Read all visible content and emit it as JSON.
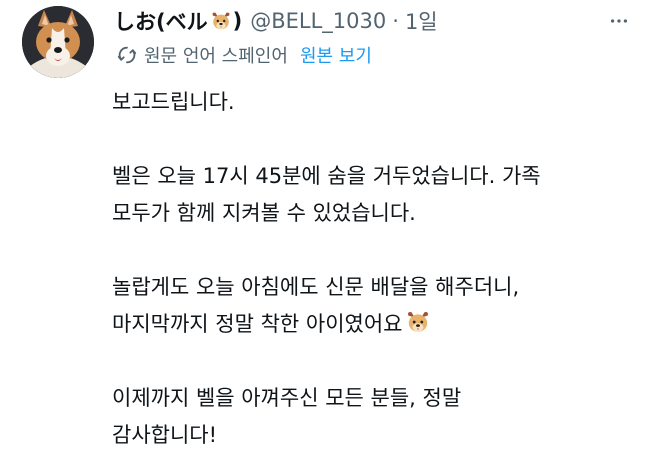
{
  "author": {
    "display_name_text": "しお(ベル",
    "display_name_close": ")",
    "name_emoji": "dog-face-emoji",
    "handle": "@BELL_1030",
    "separator": "·",
    "timestamp": "1일"
  },
  "translation": {
    "source_label": "원문 언어 스페인어",
    "view_original_label": "원본 보기"
  },
  "tweet": {
    "paragraph1_line1": "보고드립니다.",
    "paragraph2_line1": "벨은 오늘 17시 45분에 숨을 거두었습니다. 가족",
    "paragraph2_line2": "모두가 함께 지켜볼 수 있었습니다.",
    "paragraph3_line1": "놀랍게도 오늘 아침에도 신문 배달을 해주더니,",
    "paragraph3_line2": "마지막까지 정말 착한 아이였어요",
    "paragraph4_line1": "이제까지 벨을 아껴주신 모든 분들, 정말",
    "paragraph4_line2": "감사합니다!"
  },
  "colors": {
    "text": "#0f1419",
    "secondary": "#536471",
    "link": "#1d9bf0"
  }
}
